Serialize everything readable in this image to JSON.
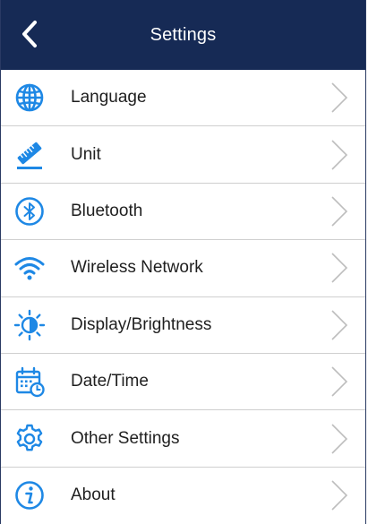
{
  "header": {
    "title": "Settings"
  },
  "items": [
    {
      "label": "Language",
      "icon": "globe-icon"
    },
    {
      "label": "Unit",
      "icon": "ruler-icon"
    },
    {
      "label": "Bluetooth",
      "icon": "bluetooth-icon"
    },
    {
      "label": "Wireless Network",
      "icon": "wifi-icon"
    },
    {
      "label": "Display/Brightness",
      "icon": "brightness-icon"
    },
    {
      "label": "Date/Time",
      "icon": "calendar-clock-icon"
    },
    {
      "label": "Other Settings",
      "icon": "gear-icon"
    },
    {
      "label": "About",
      "icon": "info-icon"
    }
  ],
  "colors": {
    "header": "#162a55",
    "accent": "#1e88e5",
    "divider": "#cfcfcf",
    "chevron": "#bdbdbd"
  }
}
